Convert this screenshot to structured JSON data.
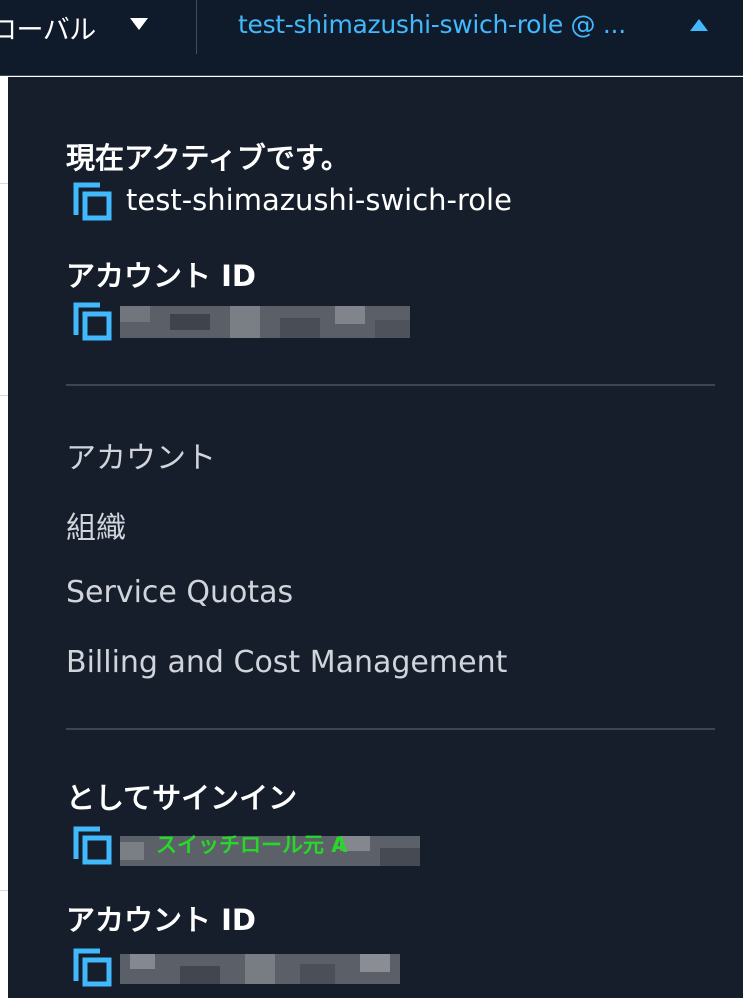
{
  "topbar": {
    "region_label": "ローバル",
    "account_menu_label": "test-shimazushi-swich-role @ ..."
  },
  "panel": {
    "active_heading": "現在アクティブです。",
    "active_role": "test-shimazushi-swich-role",
    "active_account_id_heading": "アカウント ID",
    "links": [
      {
        "label": "アカウント"
      },
      {
        "label": "組織"
      },
      {
        "label": "Service Quotas"
      },
      {
        "label": "Billing and Cost Management"
      }
    ],
    "signin_heading": "としてサインイン",
    "signin_annotation": "スイッチロール元 A",
    "signin_account_id_heading": "アカウント ID"
  },
  "colors": {
    "nav_background": "#0f1b2a",
    "panel_background": "#161e2b",
    "accent_blue": "#42b8fd",
    "annotation_green": "#26d926"
  },
  "icons": {
    "copy": "copy-icon",
    "region_caret": "caret-down-icon",
    "account_caret": "caret-up-icon"
  }
}
